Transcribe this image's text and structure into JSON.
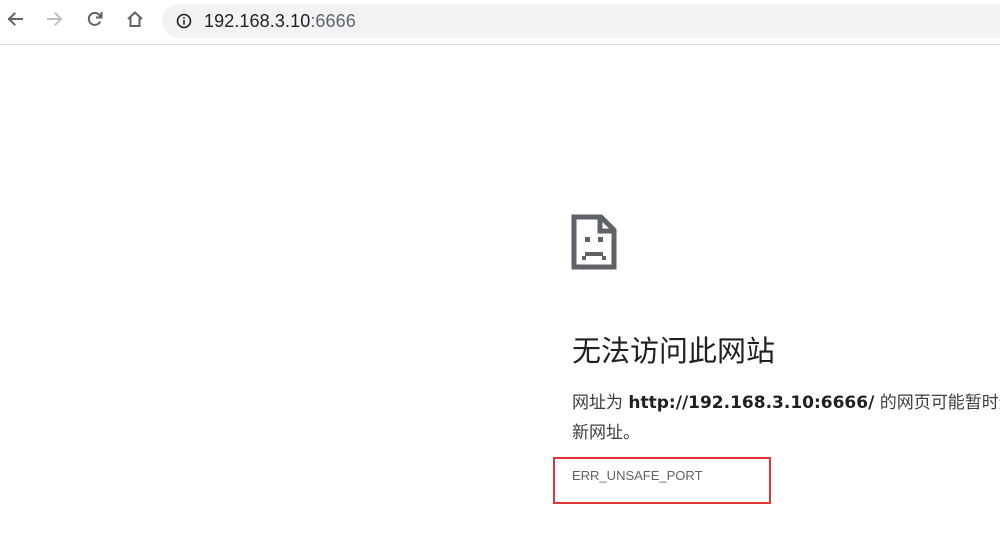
{
  "browser": {
    "url_host": "192.168.3.10",
    "url_port": ":6666",
    "icons": {
      "back": "arrow-left",
      "forward": "arrow-right",
      "reload": "reload",
      "home": "home",
      "site_info": "info-circle"
    }
  },
  "error_page": {
    "icon": "sad-document",
    "title": "无法访问此网站",
    "desc_prefix": "网址为 ",
    "desc_url": "http://192.168.3.10:6666/",
    "desc_suffix": " 的网页可能暂时无法连接，或者它已永久性地移动到了",
    "desc_line2": "新网址。",
    "error_code": "ERR_UNSAFE_PORT"
  },
  "colors": {
    "highlight": "#e0363a",
    "text_primary": "#202124",
    "text_secondary": "#5f6368"
  }
}
